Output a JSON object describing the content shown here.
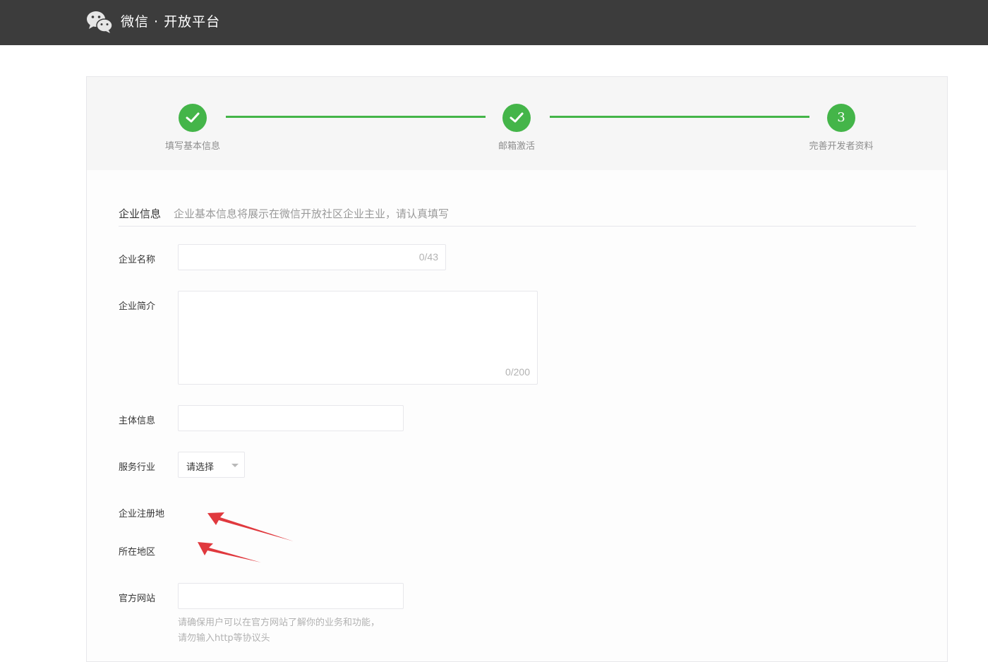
{
  "header": {
    "brand": "微信 · 开放平台",
    "logo_icon": "wechat-logo-icon",
    "bg_color": "#3c3c3c"
  },
  "steps": {
    "accent_color": "#44b549",
    "items": [
      {
        "label": "填写基本信息",
        "status": "done"
      },
      {
        "label": "邮箱激活",
        "status": "done"
      },
      {
        "label": "完善开发者资料",
        "status": "current",
        "number": "3"
      }
    ]
  },
  "section": {
    "title": "企业信息",
    "description": "企业基本信息将展示在微信开放社区企业主业，请认真填写"
  },
  "form": {
    "company_name": {
      "label": "企业名称",
      "value": "",
      "counter": "0/43"
    },
    "company_intro": {
      "label": "企业简介",
      "value": "",
      "counter": "0/200"
    },
    "entity_info": {
      "label": "主体信息",
      "value": ""
    },
    "industry": {
      "label": "服务行业",
      "selected": "请选择"
    },
    "registered_place": {
      "label": "企业注册地"
    },
    "region": {
      "label": "所在地区"
    },
    "website": {
      "label": "官方网站",
      "value": "",
      "hint_line1": "请确保用户可以在官方网站了解你的业务和功能，",
      "hint_line2": "请勿输入http等协议头"
    }
  },
  "annotations": {
    "arrow_color": "#e0393e",
    "arrow_count": "2"
  }
}
